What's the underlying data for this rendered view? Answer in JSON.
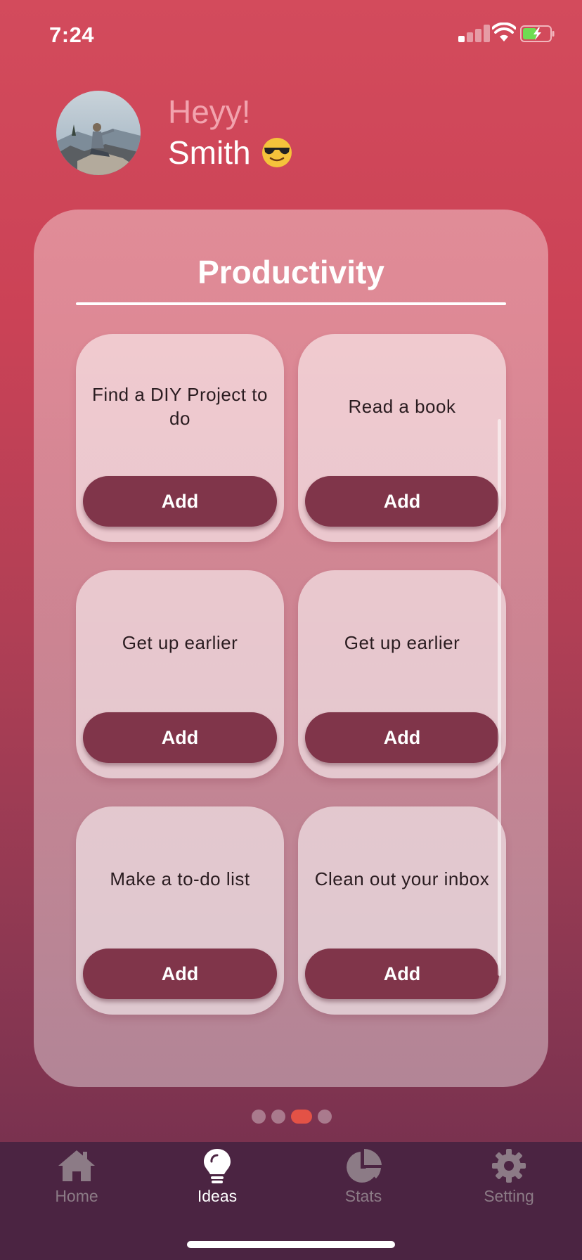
{
  "status_bar": {
    "time": "7:24",
    "icons": [
      "cellular-signal-icon",
      "wifi-icon",
      "battery-charging-icon"
    ]
  },
  "greeting": {
    "hello": "Heyy!",
    "name": "Smith",
    "emoji_icon": "sunglasses-face-emoji",
    "avatar_icon": "profile-photo-avatar"
  },
  "panel": {
    "title": "Productivity",
    "cards": [
      {
        "label": "Find a DIY Project to do",
        "button": "Add"
      },
      {
        "label": "Read a book",
        "button": "Add"
      },
      {
        "label": "Get up earlier",
        "button": "Add"
      },
      {
        "label": "Get up earlier",
        "button": "Add"
      },
      {
        "label": "Make a to-do list",
        "button": "Add"
      },
      {
        "label": "Clean out your inbox",
        "button": "Add"
      }
    ]
  },
  "pager": {
    "count": 4,
    "active_index": 2
  },
  "tabs": [
    {
      "label": "Home",
      "icon": "home-icon",
      "active": false
    },
    {
      "label": "Ideas",
      "icon": "lightbulb-icon",
      "active": true
    },
    {
      "label": "Stats",
      "icon": "pie-chart-icon",
      "active": false
    },
    {
      "label": "Setting",
      "icon": "gear-icon",
      "active": false
    }
  ],
  "colors": {
    "background_top": "#d34b5c",
    "background_bottom": "#6f2f4c",
    "button": "#80354a",
    "active_dot": "#e35246",
    "tabbar": "#4b2442",
    "greeting_hey": "#f2a3ae"
  }
}
